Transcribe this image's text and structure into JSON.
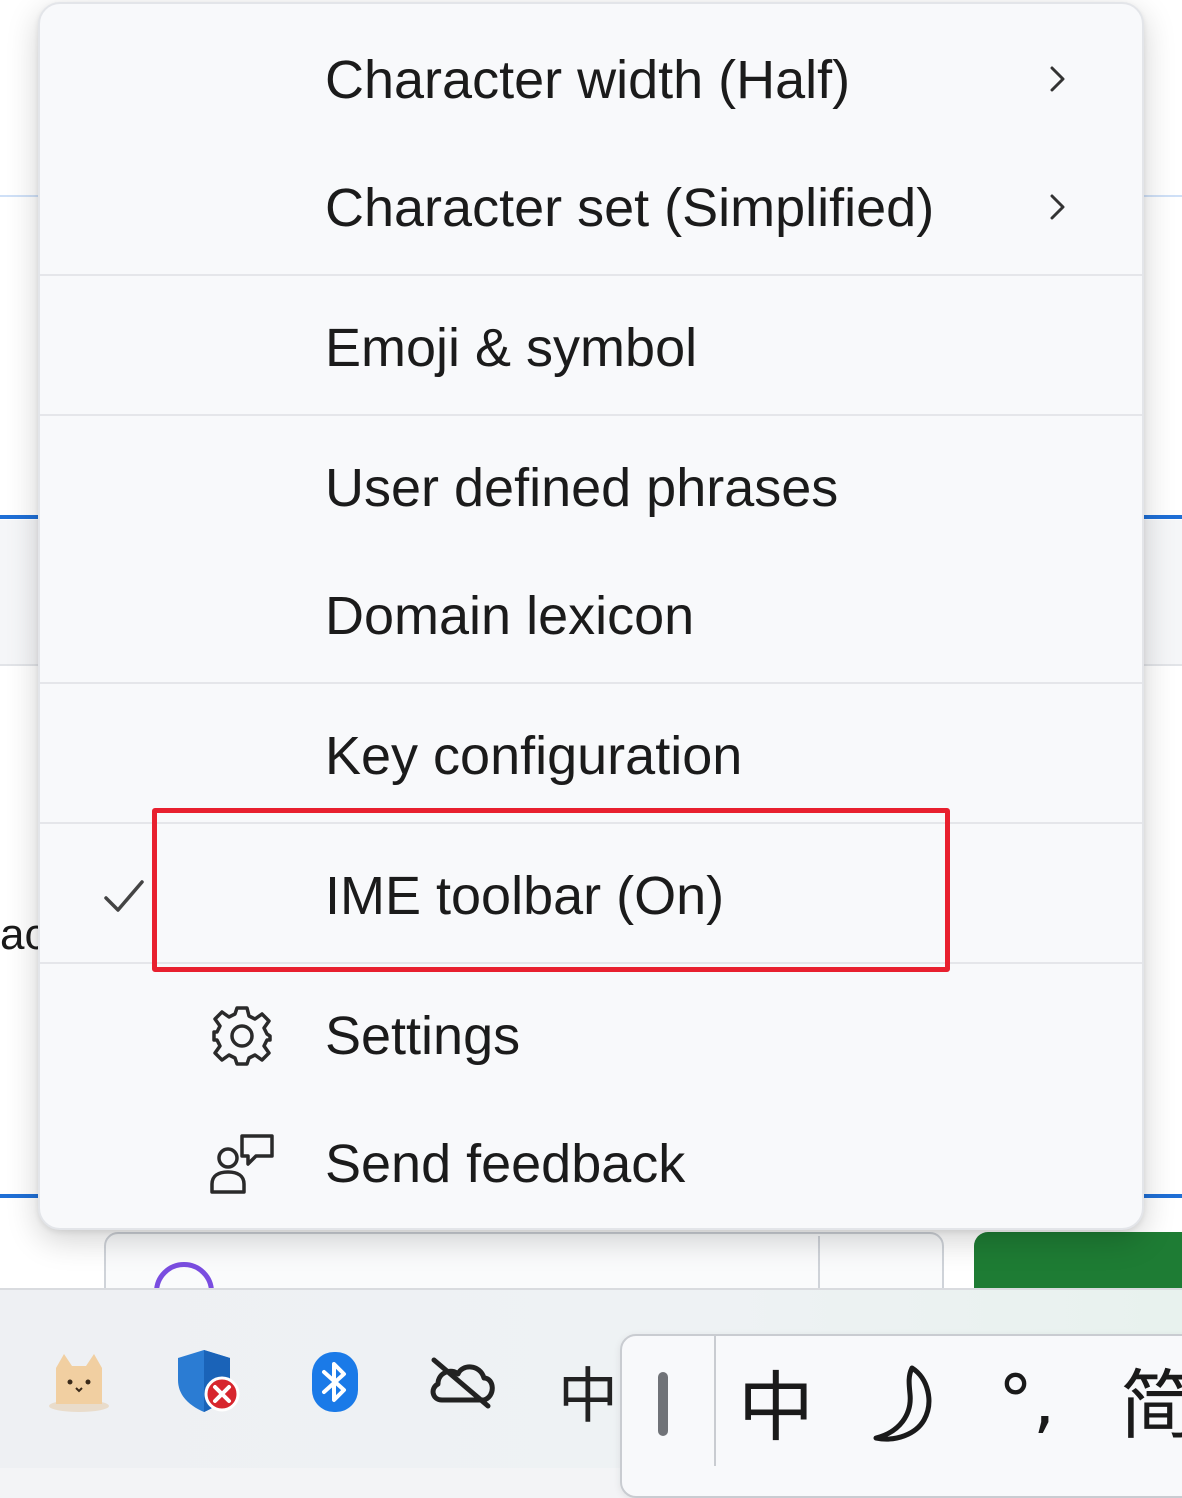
{
  "background": {
    "partial_text": "ac"
  },
  "menu": {
    "items": [
      {
        "label": "Character width (Half)",
        "has_submenu": true,
        "icon": "chevron-right-icon"
      },
      {
        "label": "Character set (Simplified)",
        "has_submenu": true,
        "icon": "chevron-right-icon"
      },
      {
        "label": "Emoji & symbol"
      },
      {
        "label": "User defined phrases"
      },
      {
        "label": "Domain lexicon"
      },
      {
        "label": "Key configuration"
      },
      {
        "label": "IME toolbar (On)",
        "checked": true,
        "highlighted": true
      },
      {
        "label": "Settings",
        "icon": "gear-icon"
      },
      {
        "label": "Send feedback",
        "icon": "feedback-icon"
      }
    ]
  },
  "taskbar": {
    "tray_icons": [
      "cat-app-icon",
      "windows-security-alert-icon",
      "bluetooth-icon",
      "onedrive-offline-icon"
    ],
    "ime_indicator": "中"
  },
  "ime_toolbar": {
    "mode_char": "中",
    "half_width_symbol": "☽",
    "punctuation": "°,",
    "charset_char": "简"
  },
  "colors": {
    "highlight": "#e8202f",
    "accent_blue": "#1f6fd6",
    "bluetooth": "#1a7ae8",
    "security_shield": "#2b7cd3",
    "alert_red": "#d7262e",
    "green_button": "#1e7c34"
  }
}
